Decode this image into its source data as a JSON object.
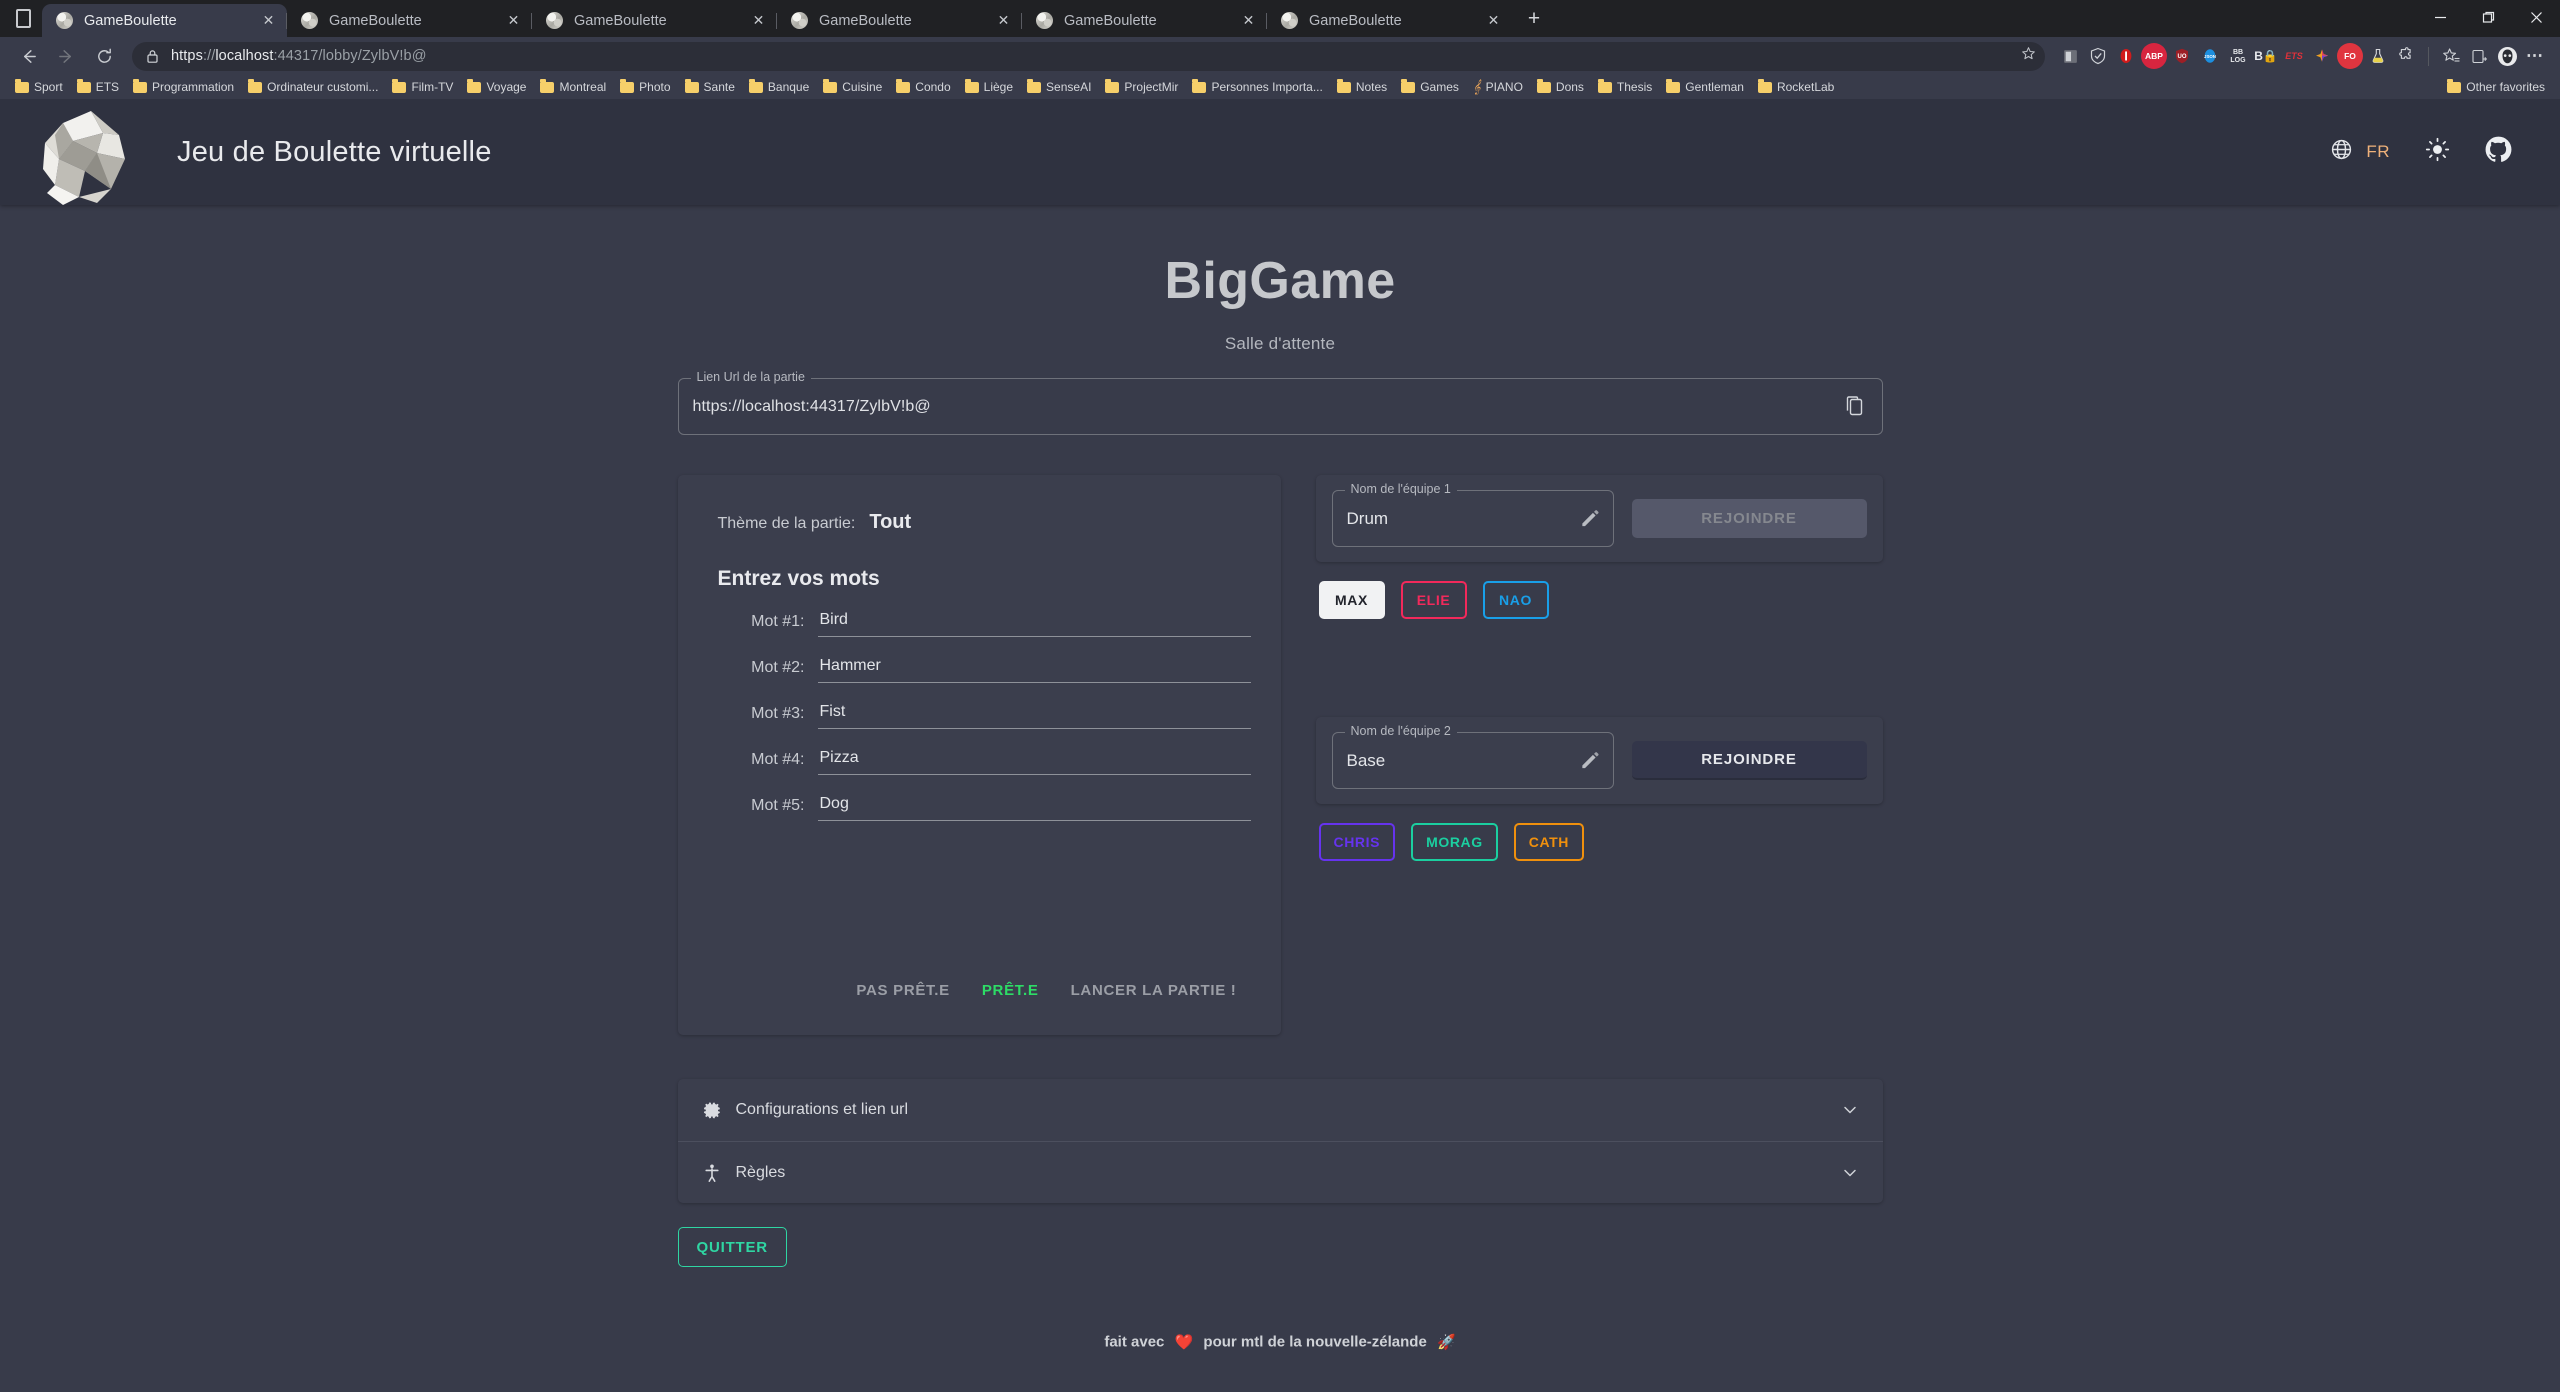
{
  "browser": {
    "tabs": [
      {
        "title": "GameBoulette",
        "active": true
      },
      {
        "title": "GameBoulette",
        "active": false
      },
      {
        "title": "GameBoulette",
        "active": false
      },
      {
        "title": "GameBoulette",
        "active": false
      },
      {
        "title": "GameBoulette",
        "active": false
      },
      {
        "title": "GameBoulette",
        "active": false
      }
    ],
    "newtab_label": "+",
    "window_controls": {
      "minimize": "—",
      "maximize": "❐",
      "close": "✕"
    },
    "nav": {
      "back": "←",
      "forward": "→",
      "reload": "⟳"
    },
    "omnibox": {
      "scheme": "https",
      "separator": "://",
      "host": "localhost",
      "rest": ":44317/lobby/ZylbV!b@",
      "full_url": "https://localhost:44317/lobby/ZylbV!b@"
    },
    "extensions": [
      {
        "name": "office-extension-icon",
        "label": "o",
        "color": "#5a5d66"
      },
      {
        "name": "shield-extension-icon",
        "label": "",
        "color": "#5a5d66"
      },
      {
        "name": "ublock-extension-icon",
        "label": "",
        "color": "#c9302c"
      },
      {
        "name": "adblock-plus-extension-icon",
        "label": "ABP",
        "color": "#d7253f"
      },
      {
        "name": "ublock-origin-extension-icon",
        "label": "UO",
        "color": "#9c1f26"
      },
      {
        "name": "json-viewer-extension-icon",
        "label": "JSON",
        "color": "#1c8fe0"
      },
      {
        "name": "bb-log-extension-icon",
        "label": "BB",
        "color": "#2f3240"
      },
      {
        "name": "bitwarden-extension-icon",
        "label": "B",
        "color": "#2f3240"
      },
      {
        "name": "ets-extension-icon",
        "label": "ETS",
        "color": "#2f3240"
      },
      {
        "name": "colorpicker-extension-icon",
        "label": "",
        "color": "#2f3240"
      },
      {
        "name": "fo-extension-icon",
        "label": "FO",
        "color": "#e0353f"
      },
      {
        "name": "flask-extension-icon",
        "label": "",
        "color": "#2f3240"
      },
      {
        "name": "puzzle-extensions-icon",
        "label": "",
        "color": "#2f3240"
      }
    ],
    "toolbar_right": [
      {
        "name": "favorites-star-icon"
      },
      {
        "name": "collections-icon"
      },
      {
        "name": "profile-avatar-icon"
      },
      {
        "name": "more-options-icon"
      }
    ],
    "bookmarks": [
      "Sport",
      "ETS",
      "Programmation",
      "Ordinateur customi...",
      "Film-TV",
      "Voyage",
      "Montreal",
      "Photo",
      "Sante",
      "Banque",
      "Cuisine",
      "Condo",
      "Liège",
      "SenseAI",
      "ProjectMir",
      "Personnes Importa...",
      "Notes",
      "Games",
      "PIANO",
      "Dons",
      "Thesis",
      "Gentleman",
      "RocketLab"
    ],
    "bookmarks_other": "Other favorites"
  },
  "app": {
    "title": "Jeu de Boulette virtuelle",
    "lang_code": "FR",
    "header_icons": {
      "globe": "globe-icon",
      "theme": "sun-icon",
      "github": "github-icon"
    },
    "game_name": "BigGame",
    "room_status": "Salle d'attente",
    "url_field": {
      "legend": "Lien Url de la partie",
      "value": "https://localhost:44317/ZylbV!b@",
      "copy_icon": "copy-icon"
    },
    "left_panel": {
      "theme_label": "Thème de la partie:",
      "theme_value": "Tout",
      "words_heading": "Entrez vos mots",
      "words": [
        {
          "label": "Mot #1:",
          "value": "Bird"
        },
        {
          "label": "Mot #2:",
          "value": "Hammer"
        },
        {
          "label": "Mot #3:",
          "value": "Fist"
        },
        {
          "label": "Mot #4:",
          "value": "Pizza"
        },
        {
          "label": "Mot #5:",
          "value": "Dog"
        }
      ],
      "actions": [
        {
          "label": "PAS PRÊT.E",
          "style": "muted"
        },
        {
          "label": "PRÊT.E",
          "style": "green"
        },
        {
          "label": "LANCER LA PARTIE !",
          "style": "muted"
        }
      ]
    },
    "teams": [
      {
        "legend": "Nom de l'équipe 1",
        "name": "Drum",
        "edit_icon": "pencil-icon",
        "join_label": "REJOINDRE",
        "join_enabled": false,
        "players": [
          {
            "name": "MAX",
            "color": "#22242c",
            "filled": true
          },
          {
            "name": "ELIE",
            "color": "#f2295b",
            "filled": false
          },
          {
            "name": "NAO",
            "color": "#199fe8",
            "filled": false
          }
        ]
      },
      {
        "legend": "Nom de l'équipe 2",
        "name": "Base",
        "edit_icon": "pencil-icon",
        "join_label": "REJOINDRE",
        "join_enabled": true,
        "players": [
          {
            "name": "CHRIS",
            "color": "#6633ee",
            "filled": false
          },
          {
            "name": "MORAG",
            "color": "#1bcfa0",
            "filled": false
          },
          {
            "name": "CATH",
            "color": "#f0900d",
            "filled": false
          }
        ]
      }
    ],
    "accordions": [
      {
        "label": "Configurations et lien url",
        "icon": "gear-icon",
        "chevron": "chevron-down-icon"
      },
      {
        "label": "Règles",
        "icon": "accessibility-icon",
        "chevron": "chevron-down-icon"
      }
    ],
    "quit_label": "QUITTER",
    "footer": {
      "prefix": "fait avec",
      "heart": "❤️",
      "middle": "pour mtl de la nouvelle-zélande",
      "rocket": "🚀"
    },
    "colors": {
      "background": "#383b4a",
      "panel": "#3b3e4d",
      "appbar": "#2f3240",
      "accent_green": "#2ddc66",
      "quit_green": "#2fd6a3",
      "lang_orange": "#f0b27a"
    }
  }
}
